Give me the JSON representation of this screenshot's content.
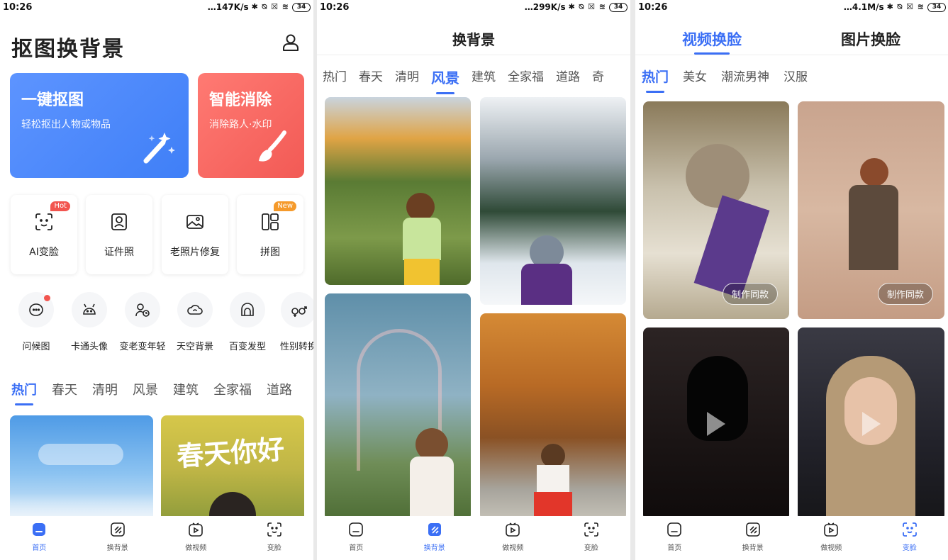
{
  "status_bars": [
    {
      "time": "10:26",
      "speed": "…147K/s",
      "battery": "34"
    },
    {
      "time": "10:26",
      "speed": "…299K/s",
      "battery": "34"
    },
    {
      "time": "10:26",
      "speed": "…4.1M/s",
      "battery": "34"
    }
  ],
  "home": {
    "title": "抠图换背景",
    "cards": [
      {
        "title": "一键抠图",
        "subtitle": "轻松抠出人物或物品"
      },
      {
        "title": "智能消除",
        "subtitle": "消除路人·水印"
      }
    ],
    "features": [
      {
        "label": "AI变脸",
        "badge": "Hot"
      },
      {
        "label": "证件照",
        "badge": ""
      },
      {
        "label": "老照片修复",
        "badge": ""
      },
      {
        "label": "拼图",
        "badge": "New"
      }
    ],
    "tools": [
      "问候图",
      "卡通头像",
      "变老变年轻",
      "天空背景",
      "百变发型",
      "性别转换"
    ],
    "categories": [
      "热门",
      "春天",
      "清明",
      "风景",
      "建筑",
      "全家福",
      "道路"
    ],
    "spring_overlay": "春天你好"
  },
  "background": {
    "title": "换背景",
    "categories": [
      "热门",
      "春天",
      "清明",
      "风景",
      "建筑",
      "全家福",
      "道路",
      "奇"
    ]
  },
  "faceswap": {
    "tabs": [
      "视频换脸",
      "图片换脸"
    ],
    "categories": [
      "热门",
      "美女",
      "潮流男神",
      "汉服"
    ],
    "make_same": "制作同款"
  },
  "bottom_nav": [
    "首页",
    "换背景",
    "做视频",
    "变脸"
  ],
  "colors": {
    "accent": "#3b6ff5",
    "hot": "#f2554f",
    "new": "#f59a2b"
  }
}
